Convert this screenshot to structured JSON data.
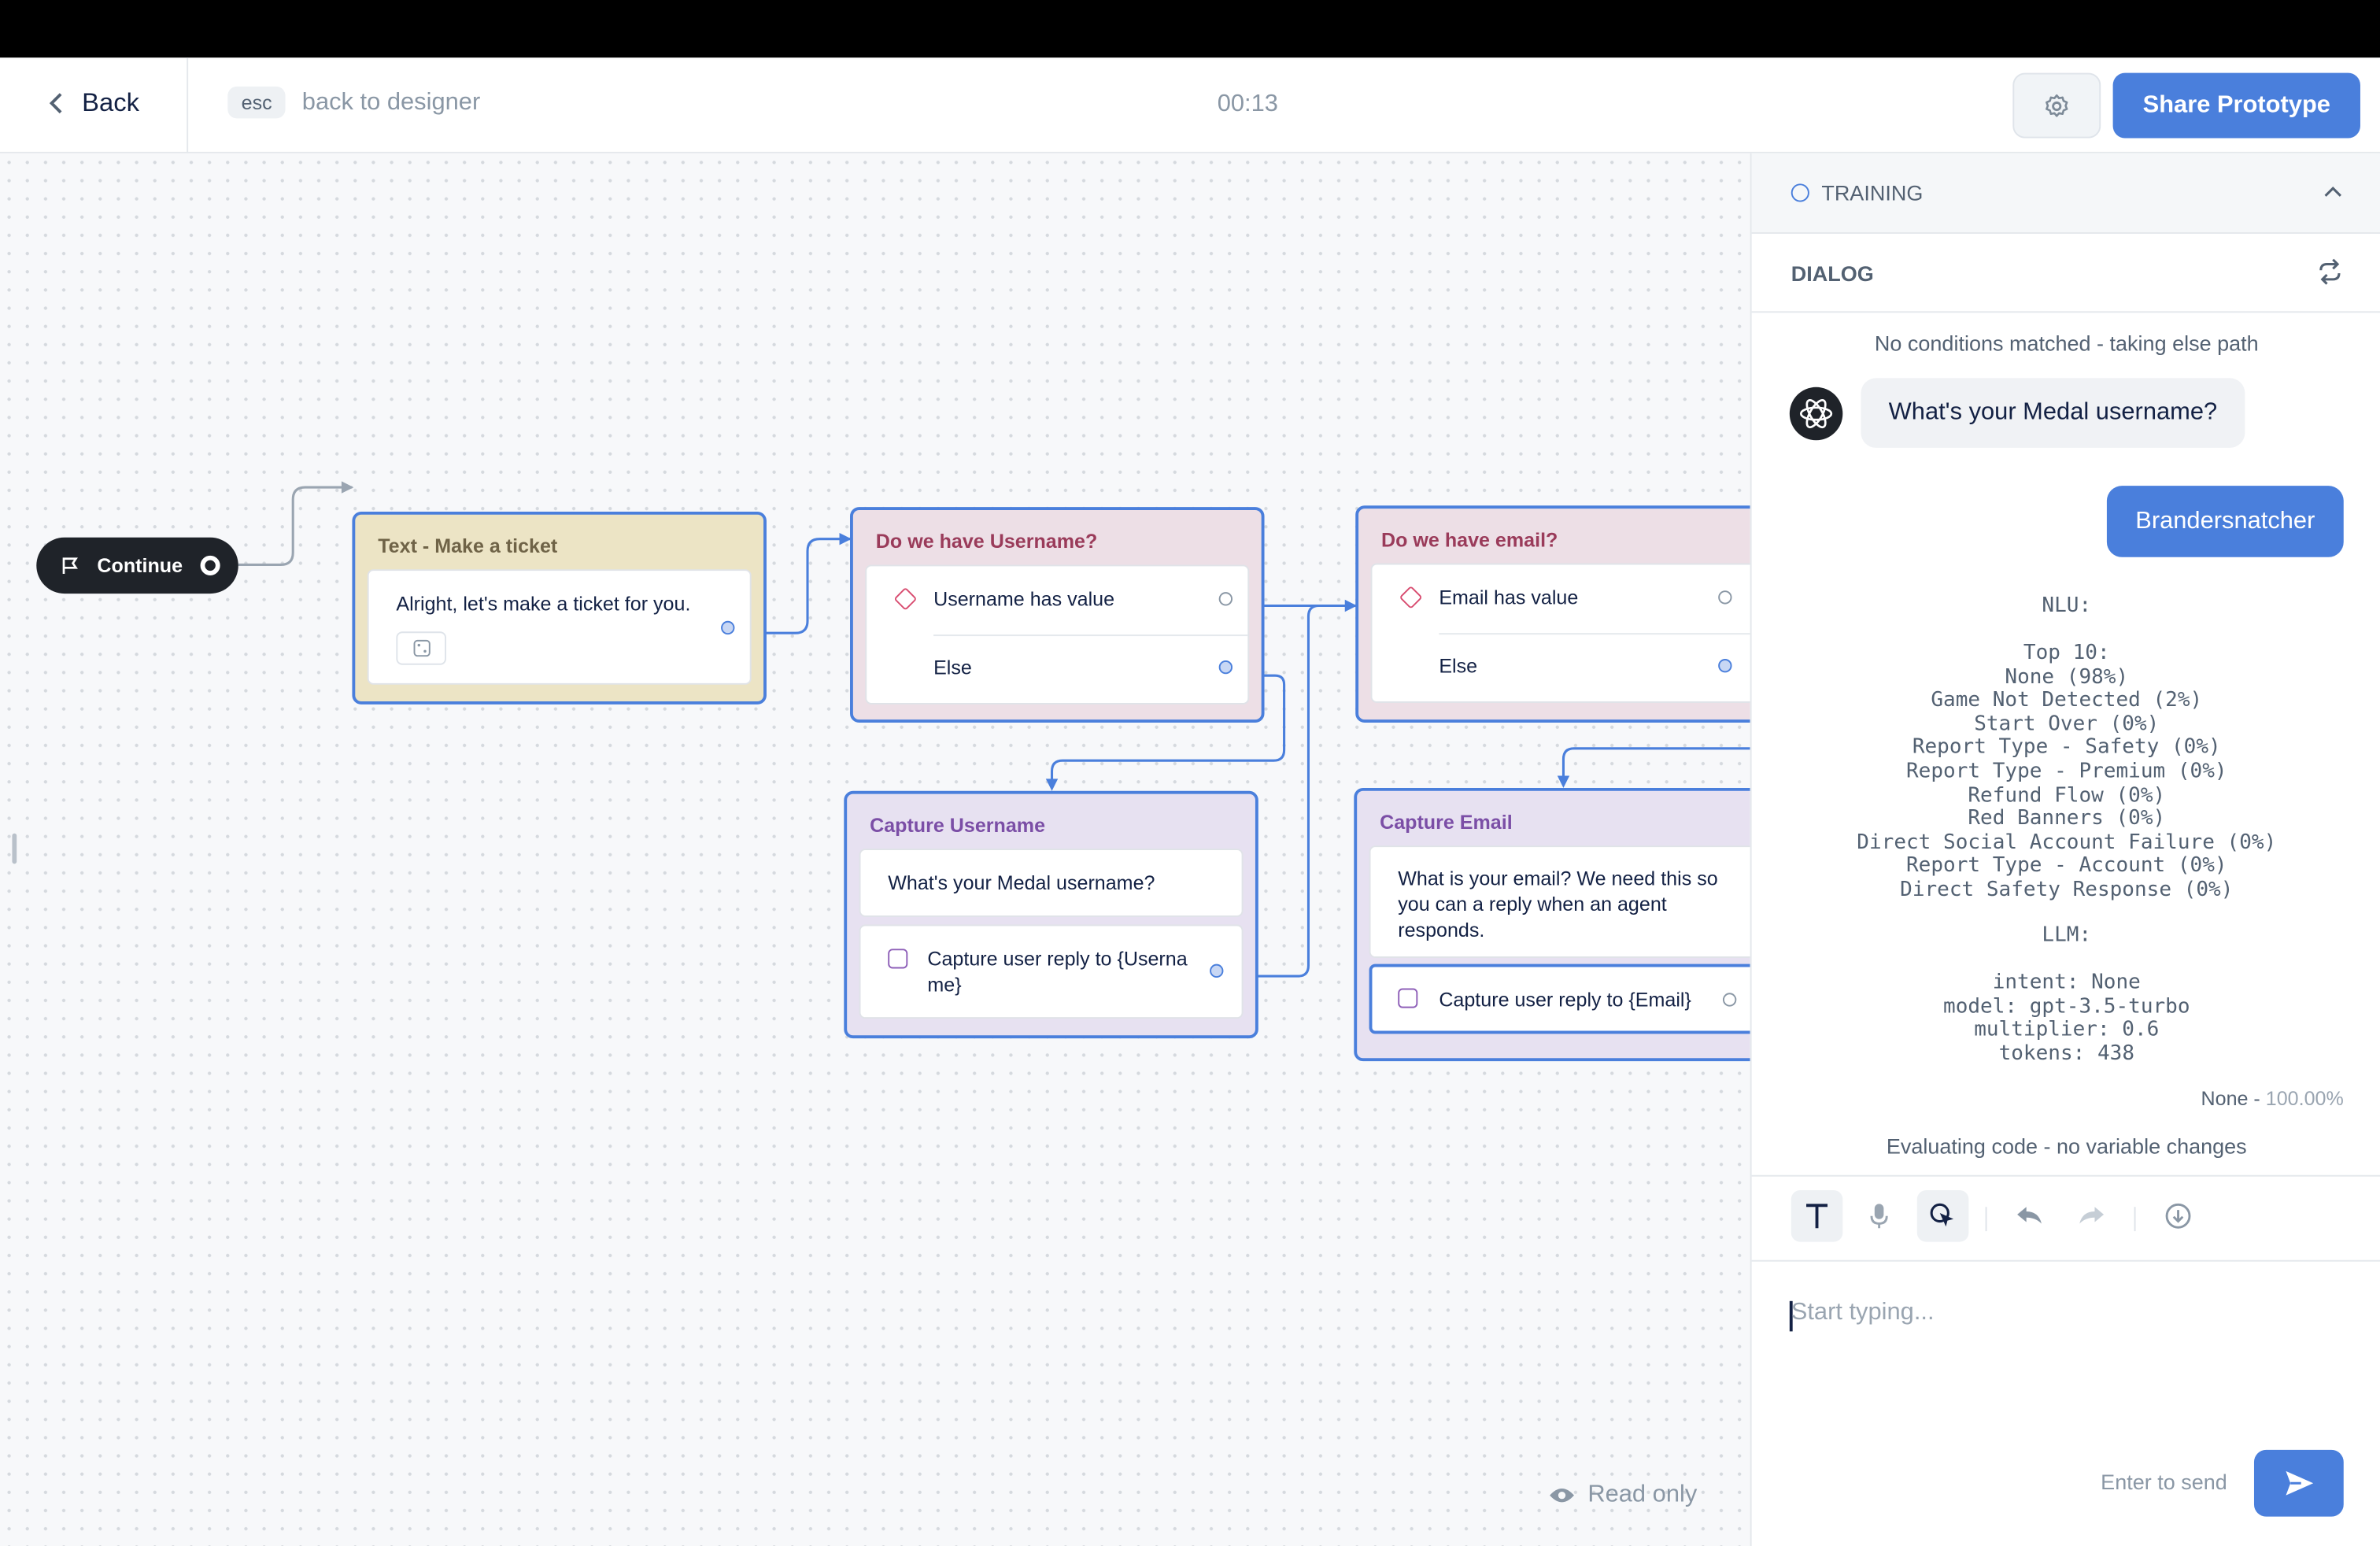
{
  "header": {
    "back_label": "Back",
    "esc_key": "esc",
    "esc_label": "back to designer",
    "timer": "00:13",
    "share_label": "Share Prototype"
  },
  "canvas": {
    "start_block": {
      "label": "Continue"
    },
    "nodes": {
      "text_ticket": {
        "title": "Text - Make a ticket",
        "text": "Alright, let's make a ticket for you."
      },
      "if_username": {
        "title": "Do we have Username?",
        "condition": "Username has value",
        "else": "Else"
      },
      "if_email": {
        "title": "Do we have email?",
        "condition": "Email has value",
        "else": "Else"
      },
      "capture_username": {
        "title": "Capture Username",
        "prompt": "What's your Medal username?",
        "capture": "Capture user reply to {Username}"
      },
      "capture_email": {
        "title": "Capture Email",
        "prompt": "What is your email? We need this so you can a reply when an agent responds.",
        "capture": "Capture user reply to {Email}"
      }
    },
    "read_only": "Read only"
  },
  "panel": {
    "training_label": "TRAINING",
    "dialog_label": "DIALOG",
    "trace_else": "No conditions matched - taking else path",
    "bot_message": "What's your Medal username?",
    "user_message": "Brandersnatcher",
    "nlu_header": "NLU:",
    "nlu_top": [
      "Top 10:",
      "None (98%)",
      "Game Not Detected (2%)",
      "Start Over (0%)",
      "Report Type - Safety (0%)",
      "Report Type - Premium (0%)",
      "Refund Flow (0%)",
      "Red Banners (0%)",
      "Direct Social Account Failure (0%)",
      "Report Type - Account (0%)",
      "Direct Safety Response (0%)"
    ],
    "llm_header": "LLM:",
    "llm_details": [
      "intent: None",
      "model: gpt-3.5-turbo",
      "multiplier: 0.6",
      "tokens: 438"
    ],
    "match_intent": "None - ",
    "match_confidence": "100.00%",
    "eval_code": "Evaluating code - no variable changes",
    "input_placeholder": "Start typing...",
    "enter_to_send": "Enter to send"
  },
  "colors": {
    "accent": "#4a7fdc",
    "text_node": "#ece4c5",
    "condition_node": "#eddfe6",
    "capture_node": "#e7e1f1"
  }
}
